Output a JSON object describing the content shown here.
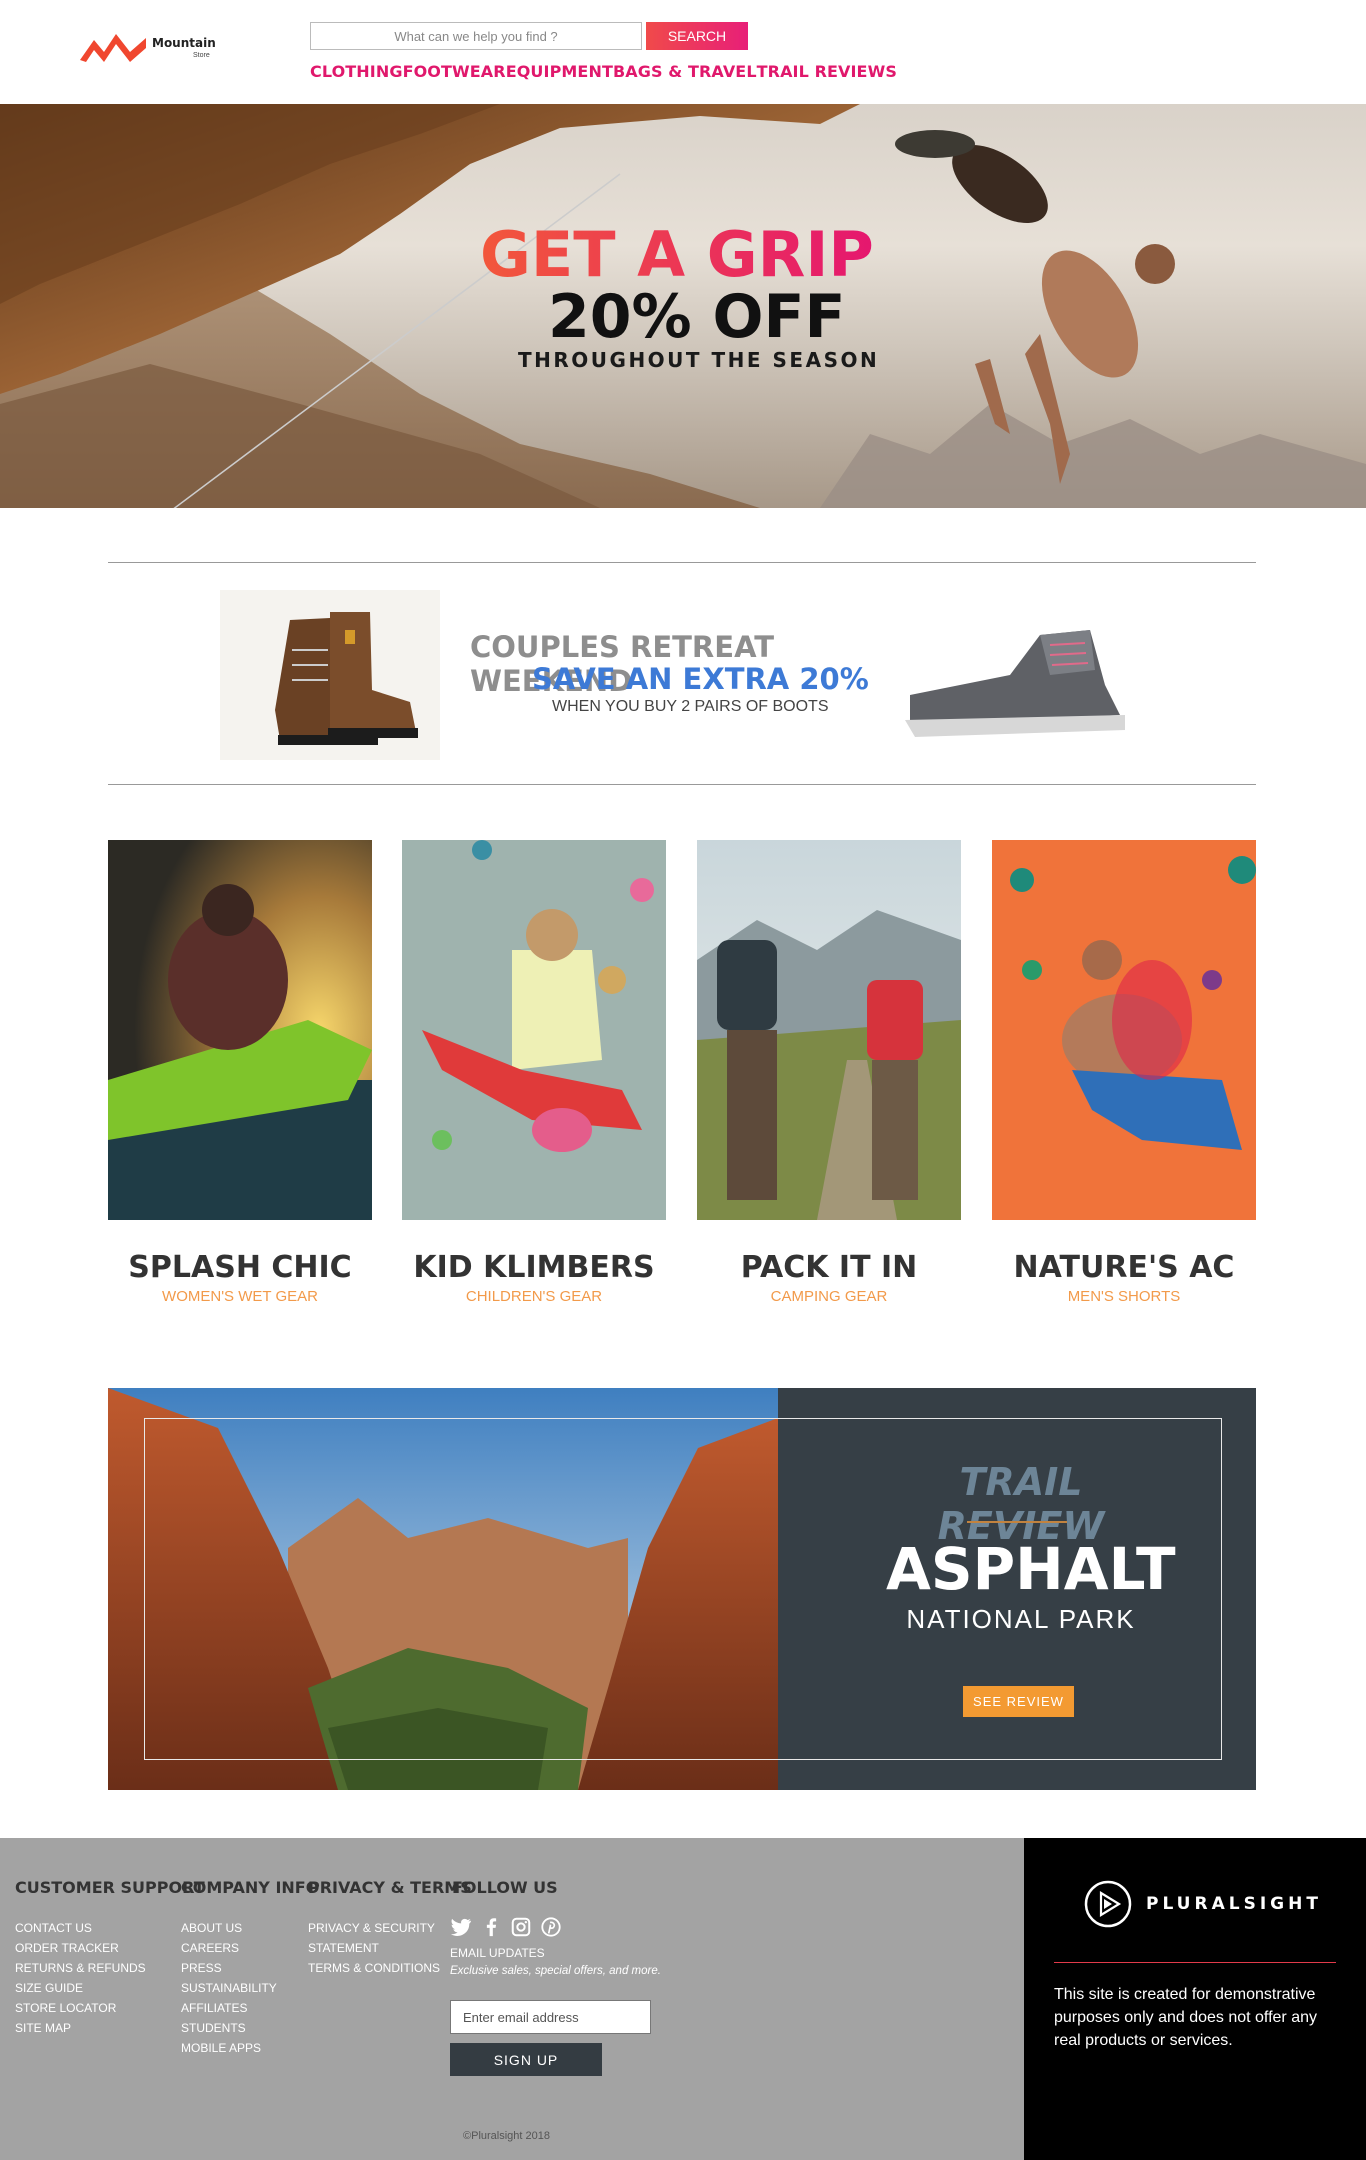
{
  "brand": {
    "name": "Mountain",
    "tagline": "Store"
  },
  "search": {
    "placeholder": "What can we help you find ?",
    "button_label": "SEARCH"
  },
  "nav": [
    "CLOTHING",
    "FOOTWEAR",
    "EQUIPMENT",
    "BAGS & TRAVEL",
    "TRAIL REVIEWS"
  ],
  "hero": {
    "headline": "GET A GRIP",
    "offer": "20% OFF",
    "subline": "THROUGHOUT THE SEASON"
  },
  "promo": {
    "line1": "COUPLES RETREAT WEEKEND",
    "line2": "SAVE AN EXTRA 20%",
    "line3": "WHEN YOU BUY 2 PAIRS OF BOOTS"
  },
  "cards": [
    {
      "title": "SPLASH CHIC",
      "subtitle": "WOMEN'S WET GEAR"
    },
    {
      "title": "KID KLIMBERS",
      "subtitle": "CHILDREN'S GEAR"
    },
    {
      "title": "PACK IT IN",
      "subtitle": "CAMPING GEAR"
    },
    {
      "title": "NATURE'S AC",
      "subtitle": "MEN'S SHORTS"
    }
  ],
  "trail": {
    "kicker": "TRAIL REVIEW",
    "name": "ASPHALT",
    "subtitle": "NATIONAL PARK",
    "button_label": "SEE REVIEW"
  },
  "footer": {
    "headings": [
      "CUSTOMER SUPPORT",
      "COMPANY INFO",
      "PRIVACY & TERMS",
      "FOLLOW US"
    ],
    "customer_support": [
      "CONTACT US",
      "ORDER TRACKER",
      "RETURNS & REFUNDS",
      "SIZE GUIDE",
      "STORE LOCATOR",
      "SITE MAP"
    ],
    "company_info": [
      "ABOUT US",
      "CAREERS",
      "PRESS",
      "SUSTAINABILITY",
      "AFFILIATES",
      "STUDENTS",
      "MOBILE APPS"
    ],
    "privacy_terms": [
      "PRIVACY & SECURITY",
      "STATEMENT",
      "TERMS & CONDITIONS"
    ],
    "social_icons": [
      "twitter-icon",
      "facebook-icon",
      "instagram-icon",
      "pinterest-icon"
    ],
    "email_label": "EMAIL UPDATES",
    "email_note": "Exclusive sales, special offers, and more.",
    "email_placeholder": "Enter email address",
    "signup_label": "SIGN UP",
    "copyright": "©Pluralsight 2018"
  },
  "sidebar": {
    "logo_text": "PLURALSIGHT",
    "disclaimer": "This site is created for demonstrative purposes only and does not offer any real products or services."
  },
  "colors": {
    "accent": "#e0186c",
    "promo_blue": "#3d7ad6",
    "cta_orange": "#f39a32",
    "panel": "#363f46",
    "footer_gray": "#a3a3a3"
  }
}
